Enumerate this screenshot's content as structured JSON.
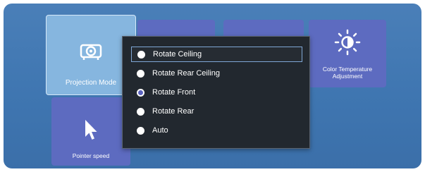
{
  "tiles": {
    "projection_mode": {
      "label": "Projection Mode",
      "icon": "projector-icon"
    },
    "color_temperature": {
      "label": "Color Temperature Adjustment",
      "icon": "brightness-icon"
    },
    "pointer_speed": {
      "label": "Pointer speed",
      "icon": "cursor-arrow-icon"
    }
  },
  "menu": {
    "items": [
      {
        "label": "Rotate Ceiling",
        "selected": false,
        "focused": true
      },
      {
        "label": "Rotate Rear Ceiling",
        "selected": false,
        "focused": false
      },
      {
        "label": "Rotate Front",
        "selected": true,
        "focused": false
      },
      {
        "label": "Rotate Rear",
        "selected": false,
        "focused": false
      },
      {
        "label": "Auto",
        "selected": false,
        "focused": false
      }
    ]
  },
  "colors": {
    "background": "#4a7fb8",
    "tile": "#5d6bc0",
    "tile_selected": "#86b6df",
    "menu_bg": "#22282f",
    "radio_checked": "#5b63c0"
  }
}
